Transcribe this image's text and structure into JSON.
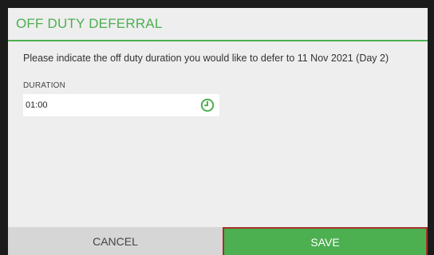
{
  "dialog": {
    "title": "OFF DUTY DEFERRAL",
    "instruction": "Please indicate the off duty duration you would like to defer to 11 Nov 2021 (Day 2)",
    "duration_label": "DURATION",
    "duration_value": "01:00",
    "cancel_label": "CANCEL",
    "save_label": "SAVE"
  },
  "icons": {
    "duration_picker": "clock-icon"
  },
  "colors": {
    "accent": "#4caf50",
    "dialog_background": "#eeeeee",
    "cancel_background": "#d6d6d6",
    "save_border": "#a5322b"
  }
}
